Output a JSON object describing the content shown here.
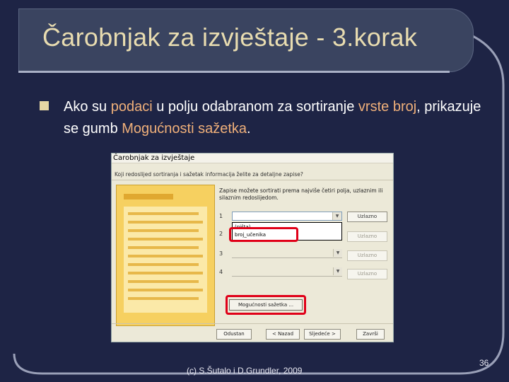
{
  "slide": {
    "title": "Čarobnjak za izvještaje - 3.korak",
    "bullet": {
      "t1": "Ako su ",
      "t2": "podaci",
      "t3": " u polju odabranom za sortiranje ",
      "t4": "vrste broj",
      "t5": ", prikazuje se gumb ",
      "t6": "Mogućnosti sažetka",
      "t7": "."
    },
    "footer": "(c) S.Šutalo i D.Grundler, 2009",
    "page_number": "36",
    "colors": {
      "background": "#1e2445",
      "title": "#e8dcb0",
      "highlight": "#f0b07a",
      "red_frame": "#e00018"
    }
  },
  "dialog": {
    "title": "Čarobnjak za izvještaje",
    "question": "Koji redoslijed sortiranja i sažetak informacija želite za detaljne zapise?",
    "info_line1": "Zapise možete sortirati prema najviše četiri polja, uzlaznim ili",
    "info_line2": "silaznim redoslijedom.",
    "sort_rows": [
      {
        "num": "1",
        "value": "",
        "button": "Uzlazno"
      },
      {
        "num": "2",
        "value": "",
        "button": "Uzlazno"
      },
      {
        "num": "3",
        "value": "",
        "button": "Uzlazno"
      },
      {
        "num": "4",
        "value": "",
        "button": "Uzlazno"
      }
    ],
    "dropdown_items": [
      "(ništa)",
      "broj_učenika"
    ],
    "summary_button": "Mogućnosti sažetka ...",
    "buttons": {
      "cancel": "Odustan",
      "back": "< Nazad",
      "next": "Sljedeće >",
      "finish": "Završi"
    }
  }
}
